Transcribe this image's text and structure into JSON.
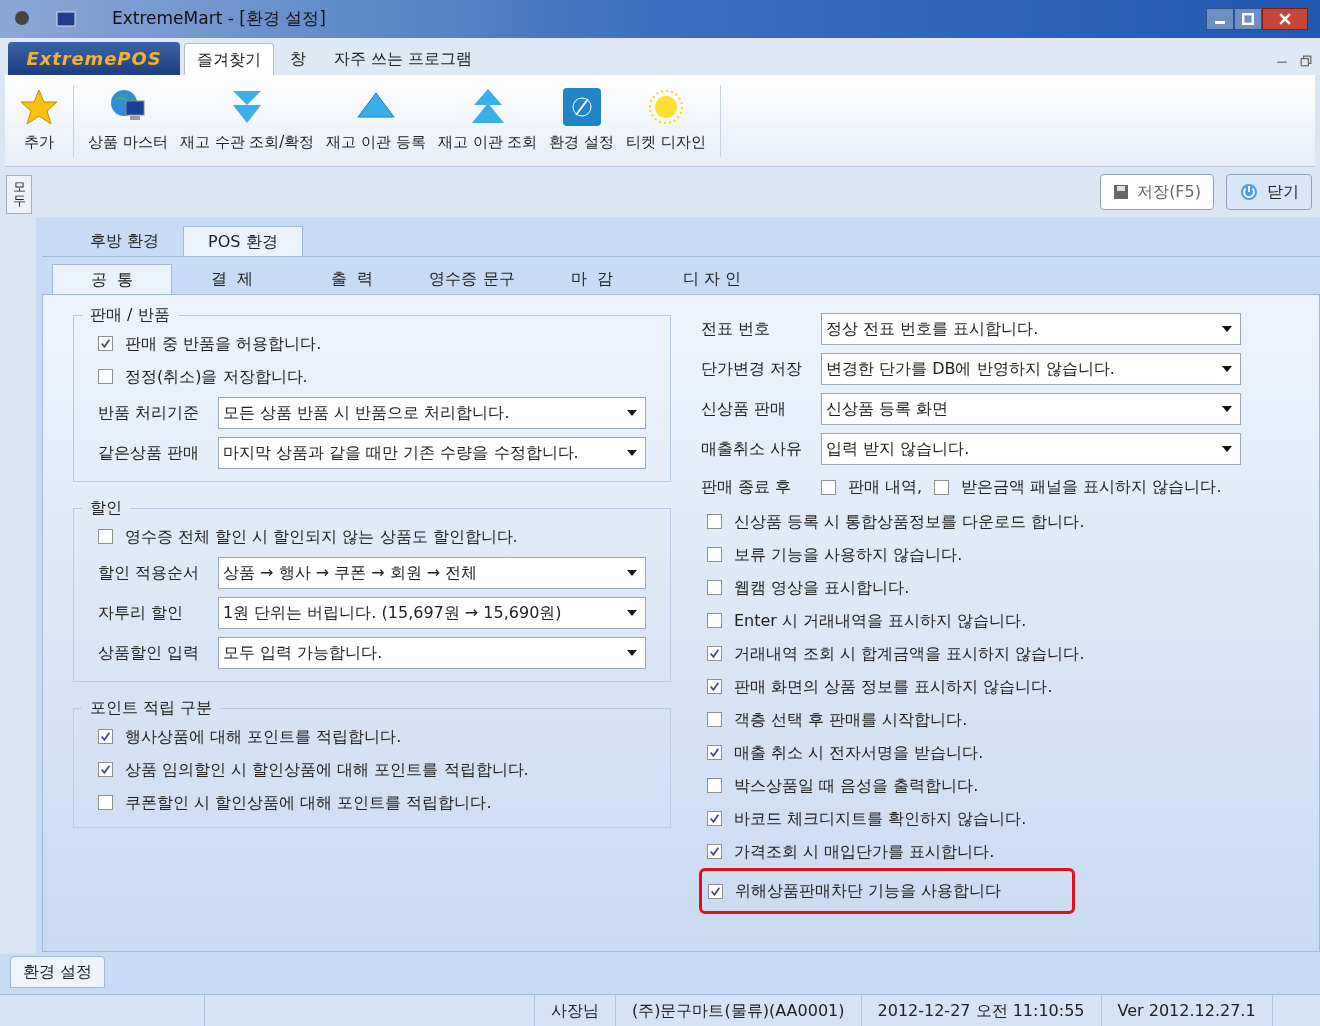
{
  "window": {
    "title": "ExtremeMart - [환경 설정]"
  },
  "logo": "ExtremePOS",
  "menu_tabs": [
    {
      "label": "즐겨찾기",
      "selected": true
    },
    {
      "label": "창",
      "selected": false
    },
    {
      "label": "자주 쓰는 프로그램",
      "selected": false
    }
  ],
  "ribbon": [
    {
      "label": "추가",
      "kind": "star"
    },
    {
      "label": "상품 마스터",
      "kind": "globe"
    },
    {
      "label": "재고 수관 조회/확정",
      "kind": "down"
    },
    {
      "label": "재고 이관 등록",
      "kind": "up"
    },
    {
      "label": "재고 이관 조회",
      "kind": "upup"
    },
    {
      "label": "환경 설정",
      "kind": "compass"
    },
    {
      "label": "티켓 디자인",
      "kind": "sun"
    }
  ],
  "side_tab": "모두",
  "actions": [
    {
      "label": "저장(F5)",
      "kind": "save"
    },
    {
      "label": "닫기",
      "kind": "power"
    }
  ],
  "outer_tabs": [
    {
      "label": "후방 환경",
      "selected": false
    },
    {
      "label": "POS 환경",
      "selected": true
    }
  ],
  "inner_tabs": [
    {
      "label": "공  통",
      "selected": true
    },
    {
      "label": "결  제",
      "selected": false
    },
    {
      "label": "출  력",
      "selected": false
    },
    {
      "label": "영수증 문구",
      "selected": false
    },
    {
      "label": "마  감",
      "selected": false
    },
    {
      "label": "디 자 인",
      "selected": false
    }
  ],
  "left_groups": [
    {
      "title": "판매 / 반품",
      "items": [
        {
          "kind": "checkbox",
          "label": "판매 중 반품을 허용합니다.",
          "checked": true
        },
        {
          "kind": "checkbox",
          "label": "정정(취소)을 저장합니다.",
          "checked": false
        },
        {
          "kind": "select",
          "label": "반품 처리기준",
          "value": "모든 상품 반품 시 반품으로 처리합니다."
        },
        {
          "kind": "select",
          "label": "같은상품 판매",
          "value": "마지막 상품과 같을 때만 기존 수량을 수정합니다."
        }
      ]
    },
    {
      "title": "할인",
      "items": [
        {
          "kind": "checkbox",
          "label": "영수증 전체 할인 시 할인되지 않는 상품도 할인합니다.",
          "checked": false
        },
        {
          "kind": "select",
          "label": "할인 적용순서",
          "value": "상품 → 행사 → 쿠폰 → 회원 → 전체"
        },
        {
          "kind": "select",
          "label": "자투리 할인",
          "value": "1원 단위는 버립니다. (15,697원 → 15,690원)"
        },
        {
          "kind": "select",
          "label": "상품할인 입력",
          "value": "모두 입력 가능합니다."
        }
      ]
    },
    {
      "title": "포인트 적립 구분",
      "items": [
        {
          "kind": "checkbox",
          "label": "행사상품에 대해 포인트를 적립합니다.",
          "checked": true
        },
        {
          "kind": "checkbox",
          "label": "상품 임의할인 시 할인상품에 대해 포인트를 적립합니다.",
          "checked": true
        },
        {
          "kind": "checkbox",
          "label": "쿠폰할인 시 할인상품에 대해 포인트를 적립합니다.",
          "checked": false
        }
      ]
    }
  ],
  "right_items": [
    {
      "kind": "select",
      "label": "전표 번호",
      "value": "정상 전표 번호를 표시합니다."
    },
    {
      "kind": "select",
      "label": "단가변경 저장",
      "value": "변경한 단가를 DB에 반영하지 않습니다."
    },
    {
      "kind": "select",
      "label": "신상품 판매",
      "value": "신상품 등록 화면"
    },
    {
      "kind": "select",
      "label": "매출취소 사유",
      "value": "입력 받지 않습니다."
    },
    {
      "kind": "pair",
      "label": "판매 종료 후",
      "options": [
        {
          "label": "판매 내역,",
          "checked": false
        },
        {
          "label": "받은금액 패널을 표시하지 않습니다.",
          "checked": false
        }
      ]
    },
    {
      "kind": "checkbox",
      "label": "신상품 등록 시 통합상품정보를 다운로드 합니다.",
      "checked": false,
      "highlighted": false
    },
    {
      "kind": "checkbox",
      "label": "보류 기능을 사용하지 않습니다.",
      "checked": false,
      "highlighted": false
    },
    {
      "kind": "checkbox",
      "label": "웹캠 영상을 표시합니다.",
      "checked": false,
      "highlighted": false
    },
    {
      "kind": "checkbox",
      "label": "Enter 시 거래내역을 표시하지 않습니다.",
      "checked": false,
      "highlighted": false
    },
    {
      "kind": "checkbox",
      "label": "거래내역 조회 시 합계금액을 표시하지 않습니다.",
      "checked": true,
      "highlighted": false
    },
    {
      "kind": "checkbox",
      "label": "판매 화면의 상품 정보를 표시하지 않습니다.",
      "checked": true,
      "highlighted": false
    },
    {
      "kind": "checkbox",
      "label": "객층 선택 후 판매를 시작합니다.",
      "checked": false,
      "highlighted": false
    },
    {
      "kind": "checkbox",
      "label": "매출 취소 시 전자서명을 받습니다.",
      "checked": true,
      "highlighted": false
    },
    {
      "kind": "checkbox",
      "label": "박스상품일 때 음성을 출력합니다.",
      "checked": false,
      "highlighted": false
    },
    {
      "kind": "checkbox",
      "label": "바코드 체크디지트를 확인하지 않습니다.",
      "checked": true,
      "highlighted": false
    },
    {
      "kind": "checkbox",
      "label": "가격조회 시 매입단가를 표시합니다.",
      "checked": true,
      "highlighted": false
    },
    {
      "kind": "checkbox",
      "label": "위해상품판매차단 기능을 사용합니다",
      "checked": true,
      "highlighted": true
    }
  ],
  "bottom_tab": "환경 설정",
  "status_bar": [
    "사장님",
    "(주)문구마트(물류)(AA0001)",
    "2012-12-27 오전  11:10:55",
    "Ver 2012.12.27.1"
  ]
}
